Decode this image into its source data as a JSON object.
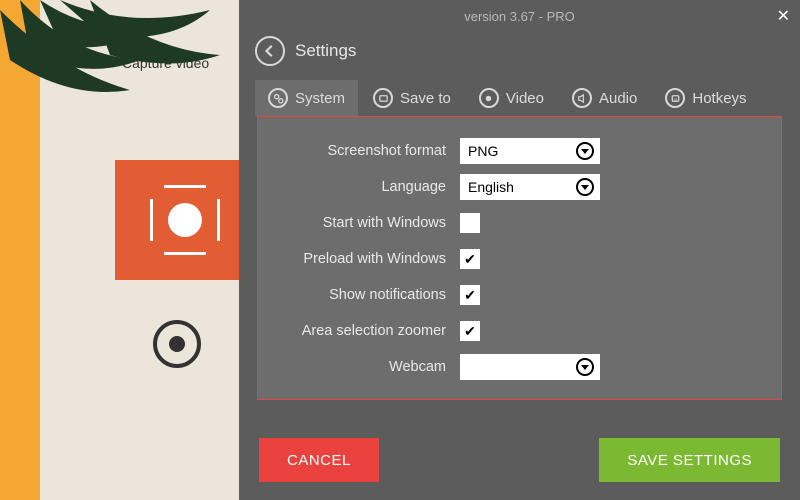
{
  "version_line": "version 3.67 - PRO",
  "bg": {
    "capture_label": "Capture video"
  },
  "dialog": {
    "title": "Settings",
    "tabs": {
      "system": "System",
      "saveto": "Save to",
      "video": "Video",
      "audio": "Audio",
      "hotkeys": "Hotkeys"
    },
    "rows": {
      "screenshot_format": {
        "label": "Screenshot format",
        "value": "PNG"
      },
      "language": {
        "label": "Language",
        "value": "English"
      },
      "start_windows": {
        "label": "Start with Windows",
        "checked": false
      },
      "preload_windows": {
        "label": "Preload with Windows",
        "checked": true
      },
      "notifications": {
        "label": "Show notifications",
        "checked": true
      },
      "area_zoomer": {
        "label": "Area selection zoomer",
        "checked": true
      },
      "webcam": {
        "label": "Webcam",
        "value": ""
      }
    },
    "buttons": {
      "cancel": "CANCEL",
      "save": "SAVE SETTINGS"
    }
  }
}
